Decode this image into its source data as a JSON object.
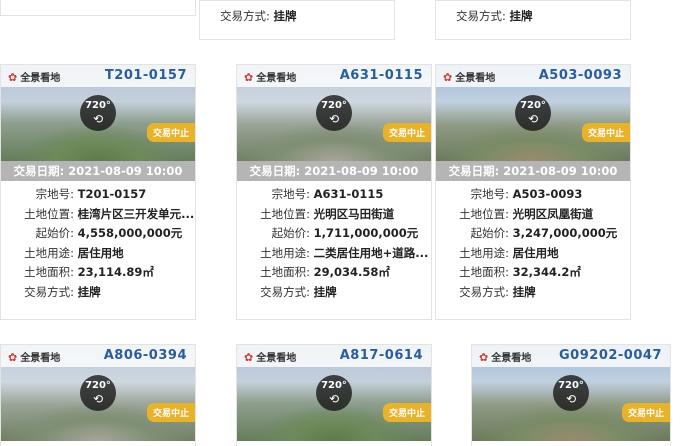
{
  "labels": {
    "parcel_no": "宗地号:",
    "location": "土地位置:",
    "start_price": "起始价:",
    "land_use": "土地用途:",
    "land_area": "土地面积:",
    "trade_method": "交易方式:",
    "trade_date_prefix": "交易日期:",
    "brand": "全景看地",
    "pano_degree": "720°",
    "status_badge": "交易中止"
  },
  "stubs": [
    {
      "trade_method": "挂牌"
    },
    {
      "trade_method": "挂牌"
    }
  ],
  "cards": [
    {
      "code": "T201-0157",
      "trade_date": "交易日期: 2021-08-09 10:00",
      "parcel_no": "T201-0157",
      "location": "桂湾片区三开发单元...",
      "start_price": "4,558,000,000元",
      "land_use": "居住用地",
      "land_area": "23,114.89㎡",
      "trade_method": "挂牌"
    },
    {
      "code": "A631-0115",
      "trade_date": "交易日期: 2021-08-09 10:00",
      "parcel_no": "A631-0115",
      "location": "光明区马田街道",
      "start_price": "1,711,000,000元",
      "land_use": "二类居住用地+道路...",
      "land_area": "29,034.58㎡",
      "trade_method": "挂牌"
    },
    {
      "code": "A503-0093",
      "trade_date": "交易日期: 2021-08-09 10:00",
      "parcel_no": "A503-0093",
      "location": "光明区凤凰街道",
      "start_price": "3,247,000,000元",
      "land_use": "居住用地",
      "land_area": "32,344.2㎡",
      "trade_method": "挂牌"
    }
  ],
  "bottom_cards": [
    {
      "code": "A806-0394"
    },
    {
      "code": "A817-0614"
    },
    {
      "code": "G09202-0047"
    }
  ]
}
